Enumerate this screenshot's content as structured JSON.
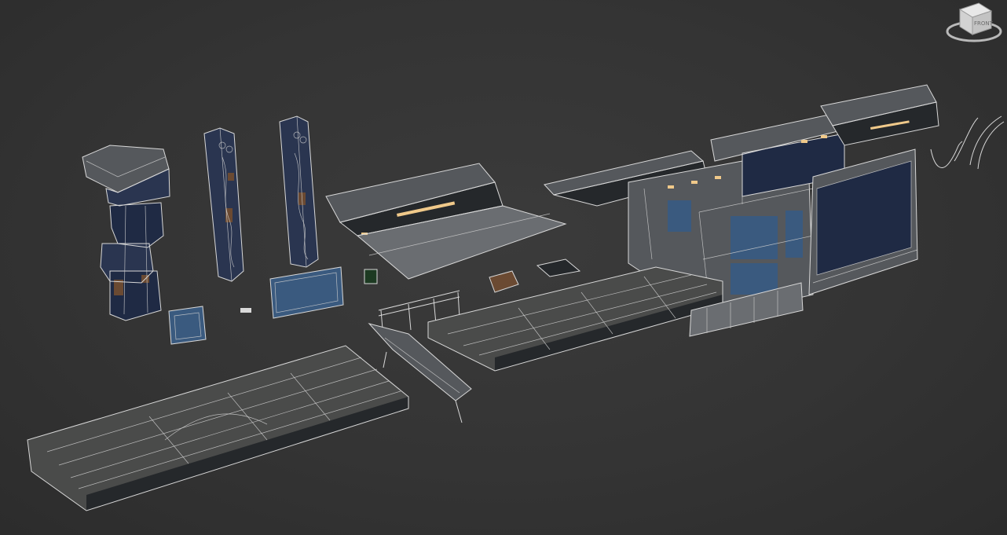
{
  "viewcube": {
    "face_label": "FRONT",
    "icon": "viewcube-icon"
  }
}
